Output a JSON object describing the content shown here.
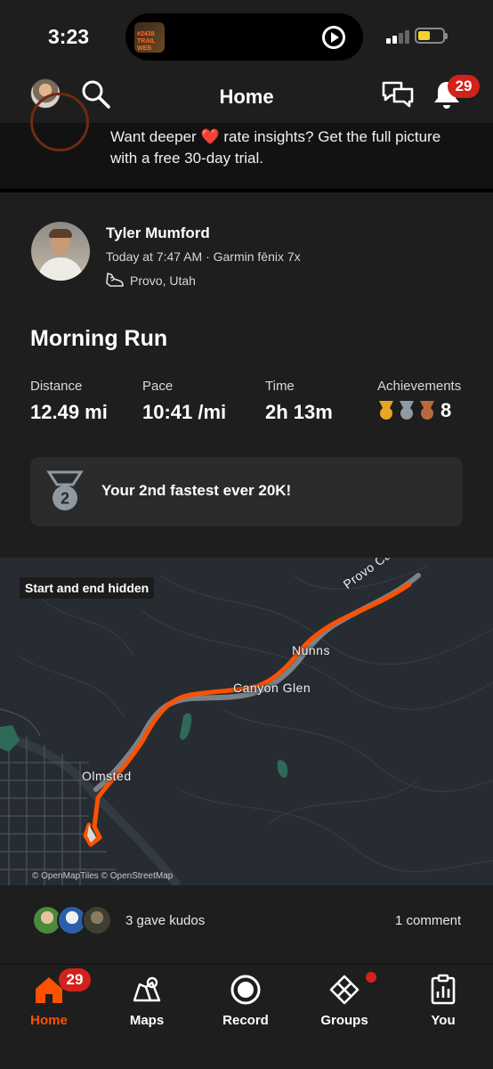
{
  "status_bar": {
    "time": "3:23",
    "media_art_text": "#2438 TRAIL WEB"
  },
  "header": {
    "title": "Home",
    "notification_count": "29"
  },
  "promo": {
    "text_before_icon": "Want deeper",
    "text_after_icon": "rate insights?  Get the full picture with a free 30-day trial."
  },
  "activity": {
    "athlete_name": "Tyler Mumford",
    "meta": "Today at 7:47 AM · Garmin fēnix 7x",
    "location": "Provo, Utah",
    "title": "Morning Run",
    "stats": {
      "distance_label": "Distance",
      "distance_value": "12.49 mi",
      "pace_label": "Pace",
      "pace_value": "10:41 /mi",
      "time_label": "Time",
      "time_value": "2h 13m",
      "achievements_label": "Achievements",
      "achievements_value": "8"
    },
    "best_effort": {
      "medal_rank": "2",
      "text": "Your 2nd fastest ever 20K!"
    }
  },
  "map": {
    "privacy_chip": "Start and end hidden",
    "labels": {
      "canyon_road": "Provo Canyon",
      "nunns": "Nunns",
      "canyon_glen": "Canyon Glen",
      "olmsted": "Olmsted"
    },
    "credit": "© OpenMapTiles © OpenStreetMap",
    "route_color": "#fc5200"
  },
  "social": {
    "kudos": "3 gave kudos",
    "comments": "1 comment"
  },
  "tabbar": {
    "home": "Home",
    "home_badge": "29",
    "maps": "Maps",
    "record": "Record",
    "groups": "Groups",
    "you": "You",
    "accent_color": "#fc5200"
  }
}
